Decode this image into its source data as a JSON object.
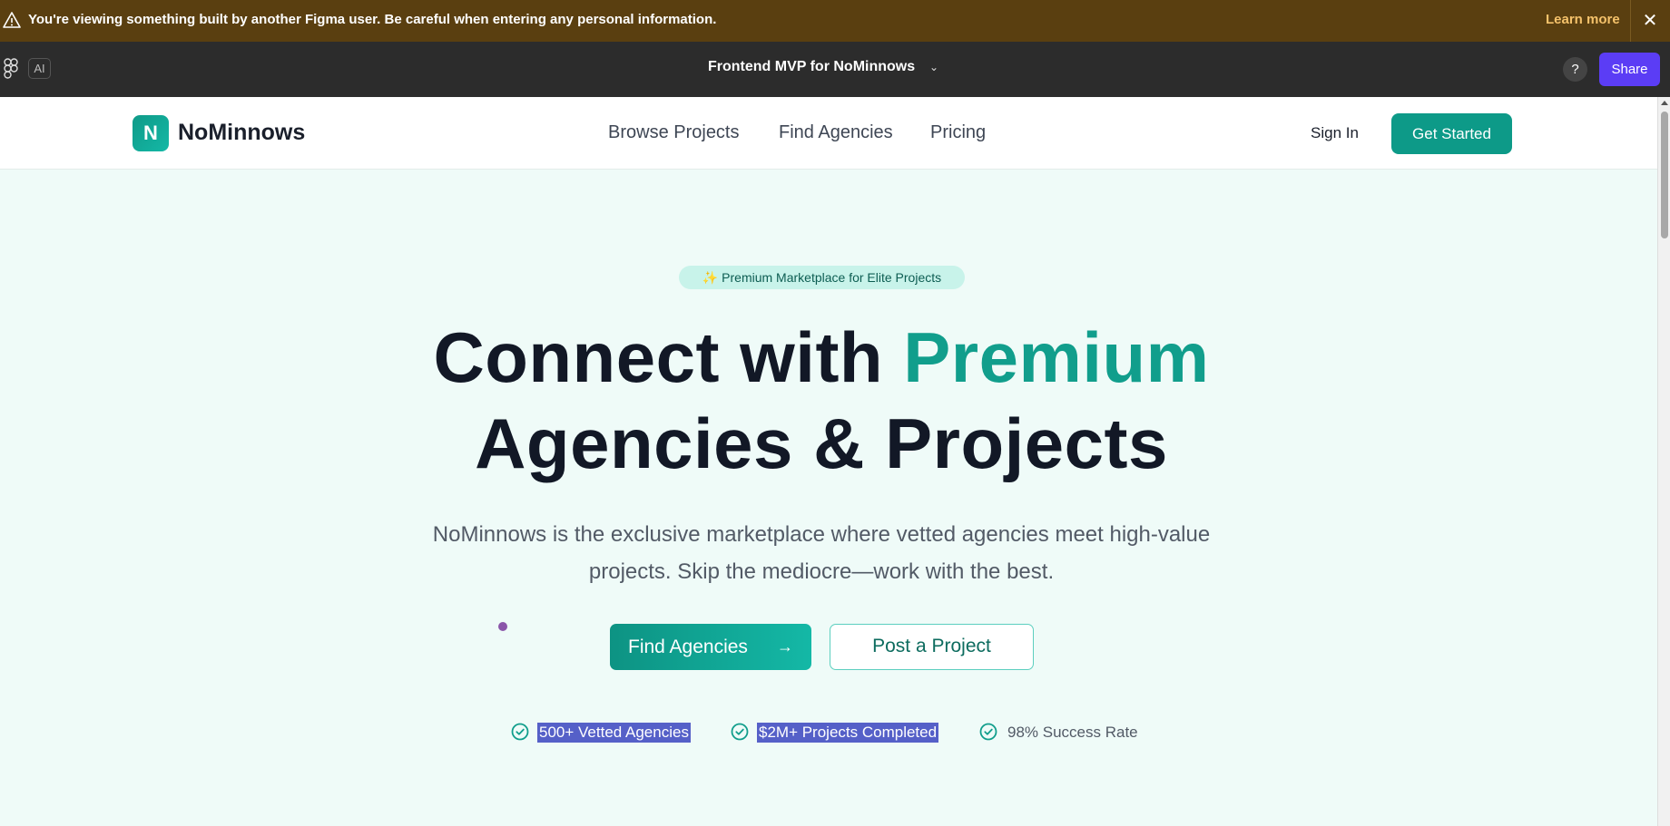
{
  "banner": {
    "message": "You're viewing something built by another Figma user. Be careful when entering any personal information.",
    "learn_more": "Learn more",
    "close_glyph": "✕",
    "icon": "warning-triangle-icon"
  },
  "toolbar": {
    "ai_label": "AI",
    "file_title": "Frontend MVP for NoMinnows",
    "chevron": "⌄",
    "help_label": "?",
    "share_label": "Share",
    "share_color": "#5b3df5"
  },
  "site": {
    "brand": {
      "mark": "N",
      "name": "NoMinnows",
      "color": "#0d9a88"
    },
    "nav": [
      "Browse Projects",
      "Find Agencies",
      "Pricing"
    ],
    "sign_in": "Sign In",
    "get_started": "Get Started"
  },
  "hero": {
    "badge": "✨ Premium Marketplace for Elite Projects",
    "title_part1": "Connect with ",
    "title_accent": "Premium",
    "title_line2": "Agencies & Projects",
    "subtitle": "NoMinnows is the exclusive marketplace where vetted agencies meet high-value projects. Skip the mediocre—work with the best.",
    "primary_cta": "Find Agencies",
    "primary_arrow": "→",
    "secondary_cta": "Post a Project",
    "accent_color": "#119e8c"
  },
  "stats": [
    {
      "label": "500+ Vetted Agencies",
      "selected": true
    },
    {
      "label": "$2M+ Projects Completed",
      "selected": true
    },
    {
      "label": "98% Success Rate",
      "selected": false
    }
  ]
}
